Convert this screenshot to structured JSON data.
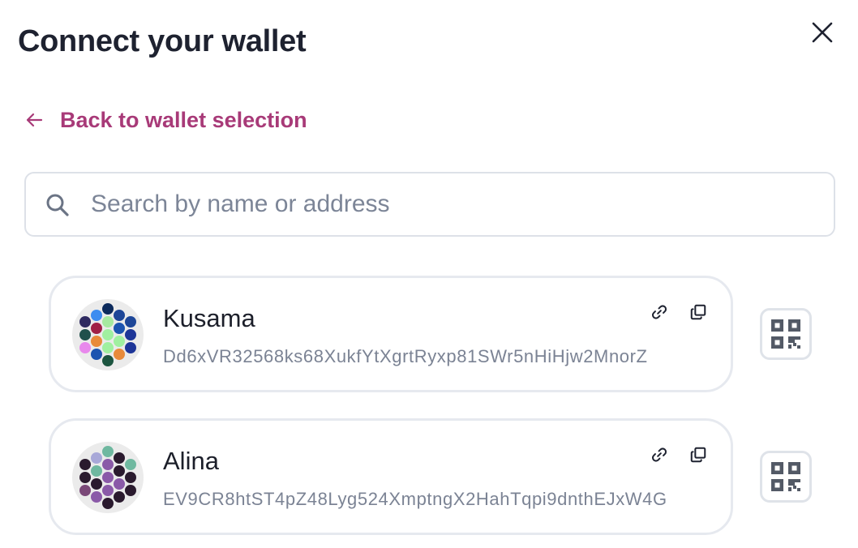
{
  "modal": {
    "title": "Connect your wallet",
    "close_icon": "close-icon"
  },
  "back": {
    "label": "Back to wallet selection",
    "icon": "arrow-left-icon",
    "color": "#a83a78"
  },
  "search": {
    "placeholder": "Search by name or address",
    "value": "",
    "icon": "search-icon"
  },
  "accounts": [
    {
      "name": "Kusama",
      "address": "Dd6xVR32568ks68XukfYtXgrtRyxp81SWr5nHiHjw2MnorZ",
      "identicon_colors": [
        "#0c2a5c",
        "#3c8cf0",
        "#1d4698",
        "#2e2a60",
        "#a6e9a0",
        "#1d4698",
        "#a02046",
        "#1c54b0",
        "#20504c",
        "#a0f0a0",
        "#1d3598",
        "#e88a3a",
        "#a0f0a0",
        "#e888ec",
        "#a0f0a0",
        "#1d3598",
        "#1c54b0",
        "#e88a3a",
        "#1c5540",
        "#3c8cf0",
        "#2e2a60",
        "#4a98f4",
        "#0c2a5c"
      ]
    },
    {
      "name": "Alina",
      "address": "EV9CR8htST4pZ48Lyg524XmptngX2HahTqpi9dnthEJxW4G",
      "identicon_colors": [
        "#6fb8a0",
        "#a8a8d8",
        "#2a1a2e",
        "#2a1a2e",
        "#8a5aa8",
        "#6fb8a0",
        "#6fb8a0",
        "#2a1a2e",
        "#2a1a2e",
        "#8a5aa8",
        "#2a1a2e",
        "#2a1a2e",
        "#8a5aa8",
        "#7a4878",
        "#8a5aa8",
        "#2a1a2e",
        "#8a5aa8",
        "#2a1a2e",
        "#2a1a2e",
        "#a8a8d8",
        "#6fb8a0",
        "#2a1a2e",
        "#6fb8a0"
      ]
    }
  ],
  "icons": {
    "link": "link-icon",
    "copy": "copy-icon",
    "qr": "qr-code-icon"
  },
  "colors": {
    "icon_gray": "#535a66",
    "border": "#e6e9ef"
  }
}
